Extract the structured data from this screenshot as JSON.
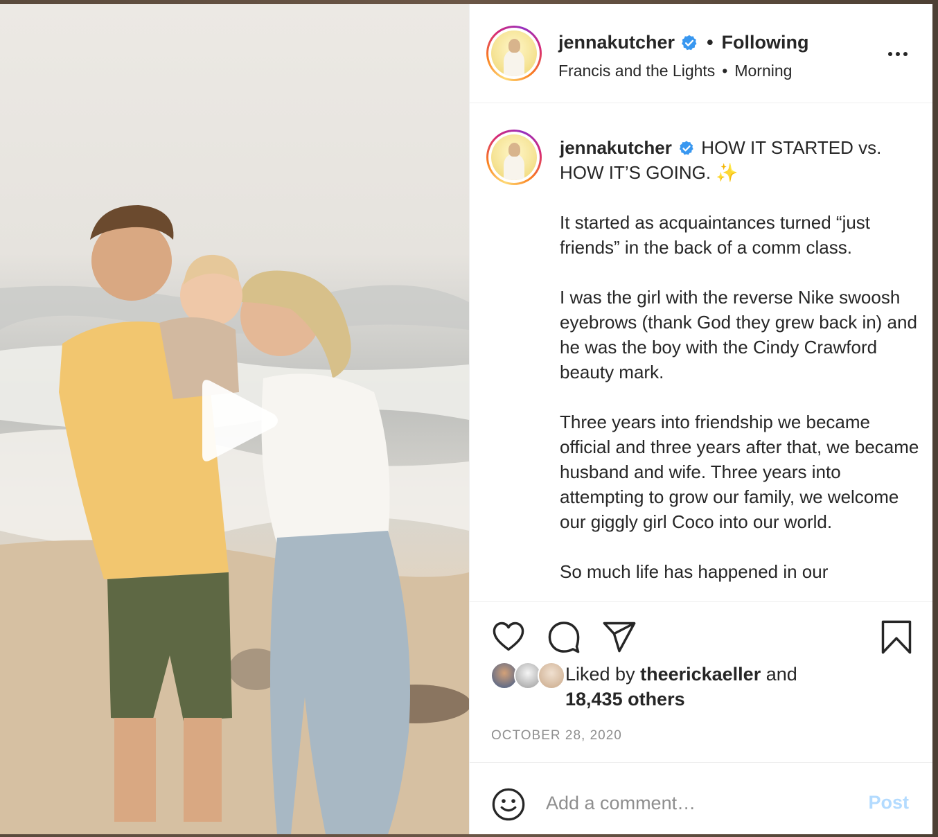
{
  "post": {
    "username": "jennakutcher",
    "separator": "•",
    "follow_status": "Following",
    "audio_artist": "Francis and the Lights",
    "audio_sep": "•",
    "audio_track": "Morning",
    "more_icon": "more-horizontal-icon",
    "media_overlay_icon": "play-icon"
  },
  "caption": {
    "username": "jennakutcher",
    "headline": "HOW IT STARTED vs. HOW IT’S GOING. ✨",
    "paragraphs": [
      "It started as acquaintances turned “just friends” in the back of a comm class.",
      "I was the girl with the reverse Nike swoosh eyebrows (thank God they grew back in) and he was the boy with the Cindy Crawford beauty mark.",
      "Three years into friendship we became official and three years after that, we became husband and wife. Three years into attempting to grow our family, we welcome our giggly girl Coco into our world.",
      "So much life has happened in our"
    ]
  },
  "actions": {
    "like_icon": "heart-icon",
    "comment_icon": "comment-icon",
    "share_icon": "paper-plane-icon",
    "save_icon": "bookmark-icon"
  },
  "likes": {
    "prefix": "Liked by",
    "liker": "theerickaeller",
    "joiner": "and",
    "others": "18,435 others"
  },
  "date": "OCTOBER 28, 2020",
  "comment": {
    "emoji_icon": "smiley-icon",
    "placeholder": "Add a comment…",
    "post_label": "Post"
  },
  "colors": {
    "verified": "#3897f0",
    "post_disabled": "#b3dbff",
    "muted": "#8e8e8e",
    "text": "#262626"
  }
}
